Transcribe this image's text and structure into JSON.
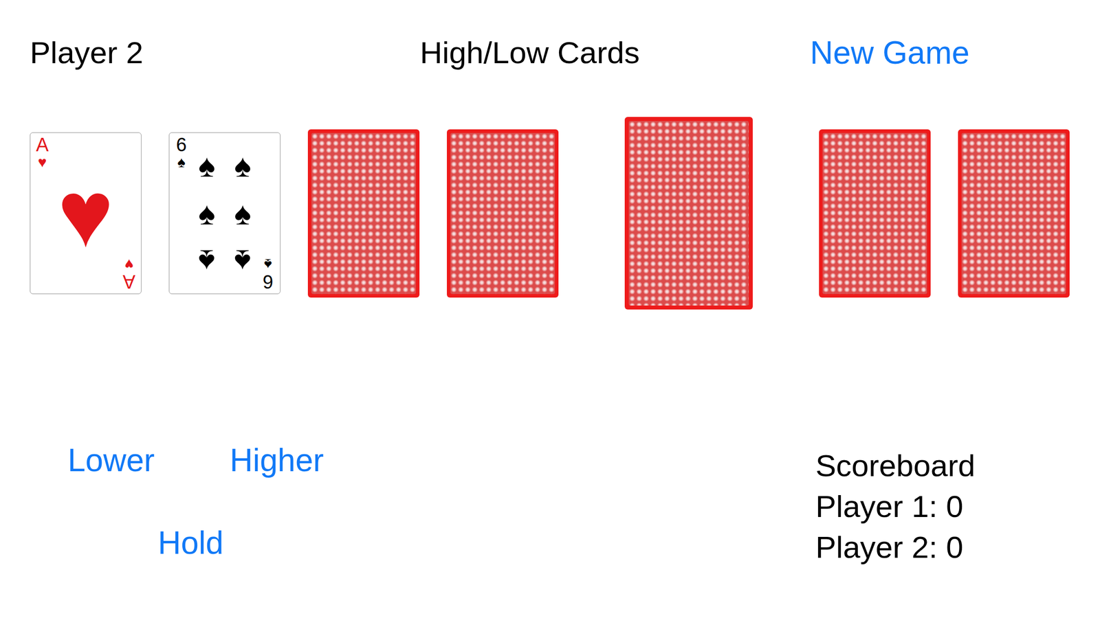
{
  "header": {
    "player": "Player 2",
    "title": "High/Low Cards",
    "new_game": "New Game"
  },
  "player_hand": [
    {
      "face_up": true,
      "rank": "A",
      "suit": "♥",
      "color": "#e3161c"
    },
    {
      "face_up": true,
      "rank": "6",
      "suit": "♠",
      "color": "#000000"
    },
    {
      "face_up": false
    },
    {
      "face_up": false
    }
  ],
  "deck": {
    "face_up": false
  },
  "opponent_hand": [
    {
      "face_up": false
    },
    {
      "face_up": false
    }
  ],
  "buttons": {
    "lower": "Lower",
    "higher": "Higher",
    "hold": "Hold"
  },
  "scoreboard": {
    "title": "Scoreboard",
    "rows": [
      "Player 1: 0",
      "Player 2: 0"
    ]
  }
}
